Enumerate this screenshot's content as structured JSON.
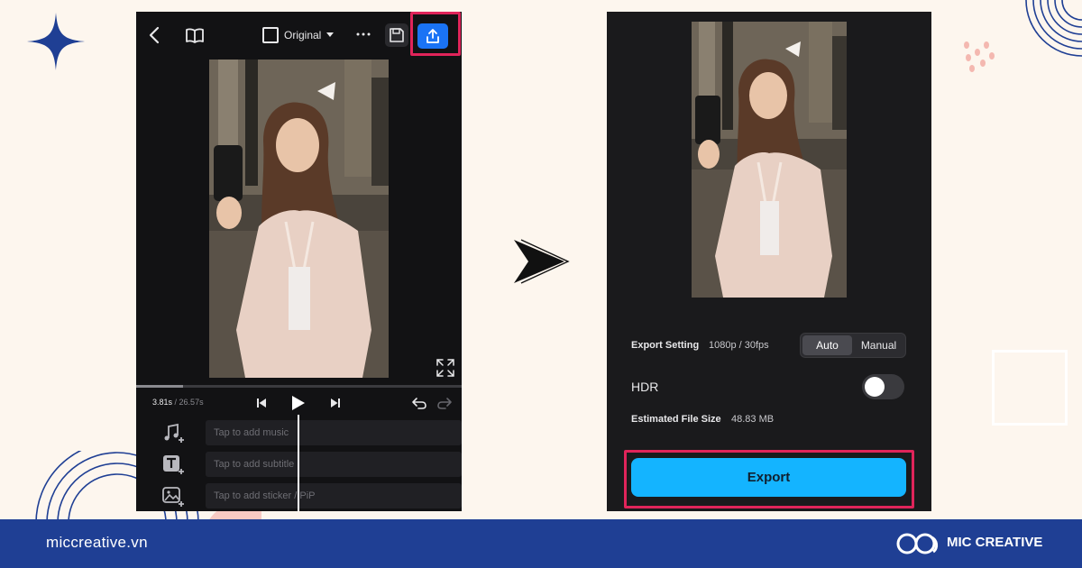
{
  "editor": {
    "ratio_label": "Original",
    "current_time": "3.81s",
    "total_time": "/ 26.57s",
    "tracks": [
      {
        "icon": "music-add-icon",
        "placeholder": "Tap to add music"
      },
      {
        "icon": "text-add-icon",
        "placeholder": "Tap to add subtitle"
      },
      {
        "icon": "sticker-add-icon",
        "placeholder": "Tap to add sticker / PiP"
      }
    ],
    "highlight_color": "#e0245a",
    "share_button_color": "#1a73f5"
  },
  "export_screen": {
    "setting_label": "Export Setting",
    "setting_value": "1080p / 30fps",
    "mode_auto": "Auto",
    "mode_manual": "Manual",
    "selected_mode": "Auto",
    "hdr_label": "HDR",
    "hdr_enabled": false,
    "file_size_label": "Estimated File Size",
    "file_size_value": "48.83 MB",
    "export_label": "Export",
    "export_button_color": "#14b4ff"
  },
  "footer": {
    "url": "miccreative.vn",
    "brand": "MIC CREATIVE",
    "background_color": "#1f3f94"
  }
}
